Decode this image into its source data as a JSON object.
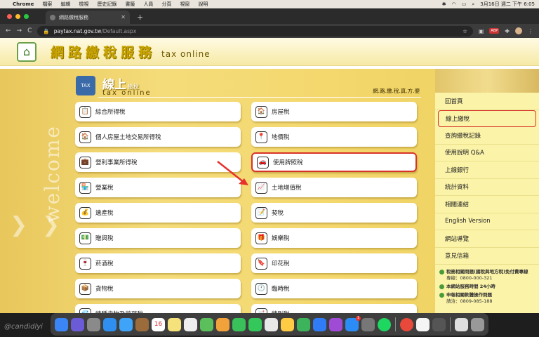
{
  "menubar": {
    "apple": "",
    "app": "Chrome",
    "items": [
      "檔案",
      "編輯",
      "檢視",
      "歷史記錄",
      "書籤",
      "人員",
      "分頁",
      "視窗",
      "說明"
    ],
    "clock": "3月16日 週二 下午 6:05"
  },
  "browser": {
    "tab_title": "網路繳稅服務",
    "new_tab": "+",
    "back": "←",
    "forward": "→",
    "reload": "C",
    "domain": "paytax.nat.gov.tw",
    "path": "/Default.aspx",
    "star": "☆",
    "abp": "ABP"
  },
  "banner": {
    "brand": "網路繳稅服務",
    "brand_en": "tax online"
  },
  "section": {
    "tax_badge": "TAX",
    "title": "線上",
    "title_sub": "繳稅",
    "title_en": "tax online",
    "slogan": "網.路.繳.稅.真.方.便"
  },
  "deco": {
    "welcome": "welcome"
  },
  "tax_items": [
    {
      "label": "綜合所得稅",
      "icon": "📋"
    },
    {
      "label": "房屋稅",
      "icon": "🏠"
    },
    {
      "label": "個人房屋土地交易所得稅",
      "icon": "🏠"
    },
    {
      "label": "地價稅",
      "icon": "📍"
    },
    {
      "label": "營利事業所得稅",
      "icon": "💼"
    },
    {
      "label": "使用牌照稅",
      "icon": "🚗"
    },
    {
      "label": "營業稅",
      "icon": "🏪"
    },
    {
      "label": "土地增值稅",
      "icon": "📈"
    },
    {
      "label": "遺產稅",
      "icon": "💰"
    },
    {
      "label": "契稅",
      "icon": "📝"
    },
    {
      "label": "贈與稅",
      "icon": "💵"
    },
    {
      "label": "娛樂稅",
      "icon": "🎁"
    },
    {
      "label": "菸酒稅",
      "icon": "🍷"
    },
    {
      "label": "印花稅",
      "icon": "🔖"
    },
    {
      "label": "貨物稅",
      "icon": "📦"
    },
    {
      "label": "臨時稅",
      "icon": "🕐"
    },
    {
      "label": "特種貨物及勞務稅",
      "icon": "💎"
    },
    {
      "label": "特別稅",
      "icon": "📑"
    }
  ],
  "active_item": "使用牌照稅",
  "sidebar": {
    "items": [
      "回首頁",
      "線上繳稅",
      "查詢繳稅記錄",
      "使用說明 Q&A",
      "上線銀行",
      "統計資料",
      "相關連結",
      "English Version",
      "網站導覽",
      "意見信箱"
    ],
    "current": "線上繳稅"
  },
  "contact": [
    {
      "title": "稅務相關問題(國稅與地方稅)免付費專線",
      "detail": "專線：0800-000-321"
    },
    {
      "title": "本網站服務時間 24小時",
      "detail": ""
    },
    {
      "title": "申報相關軟體操作問題",
      "detail": "請洽：0809-085-188"
    }
  ],
  "watermark": "@candidlyi",
  "colors": {
    "accent": "#d8332a",
    "gold": "#c9a400",
    "page_bg": "#f4d86e",
    "sidebar_bg": "#fbf3a8"
  },
  "dock": {
    "calendar_day": "16",
    "appstore_badge": "1"
  }
}
